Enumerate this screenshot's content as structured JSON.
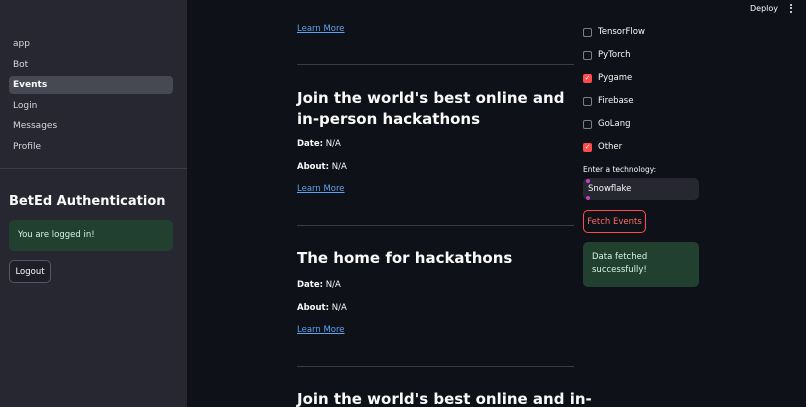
{
  "header": {
    "deploy_label": "Deploy"
  },
  "sidebar": {
    "nav": [
      {
        "label": "app",
        "active": false
      },
      {
        "label": "Bot",
        "active": false
      },
      {
        "label": "Events",
        "active": true
      },
      {
        "label": "Login",
        "active": false
      },
      {
        "label": "Messages",
        "active": false
      },
      {
        "label": "Profile",
        "active": false
      }
    ],
    "auth_title": "BetEd Authentication",
    "login_status": "You are logged in!",
    "logout_label": "Logout"
  },
  "events": {
    "top_link": "Learn More",
    "items": [
      {
        "title": "Join the world's best online and in-person hackathons",
        "date_label": "Date:",
        "date_value": " N/A",
        "about_label": "About:",
        "about_value": " N/A",
        "link": "Learn More"
      },
      {
        "title": "The home for hackathons",
        "date_label": "Date:",
        "date_value": " N/A",
        "about_label": "About:",
        "about_value": " N/A",
        "link": "Learn More"
      },
      {
        "title": "Join the world's best online and in-"
      }
    ]
  },
  "filters": {
    "technologies": [
      {
        "label": "TensorFlow",
        "checked": false
      },
      {
        "label": "PyTorch",
        "checked": false
      },
      {
        "label": "Pygame",
        "checked": true
      },
      {
        "label": "Firebase",
        "checked": false
      },
      {
        "label": "GoLang",
        "checked": false
      },
      {
        "label": "Other",
        "checked": true
      }
    ],
    "input_label": "Enter a technology:",
    "input_value": "Snowflake",
    "fetch_label": "Fetch Events",
    "status_message": "Data fetched successfully!"
  },
  "colors": {
    "accent": "#ff4b4b",
    "link": "#5da3f0",
    "success_bg": "#21402f"
  }
}
